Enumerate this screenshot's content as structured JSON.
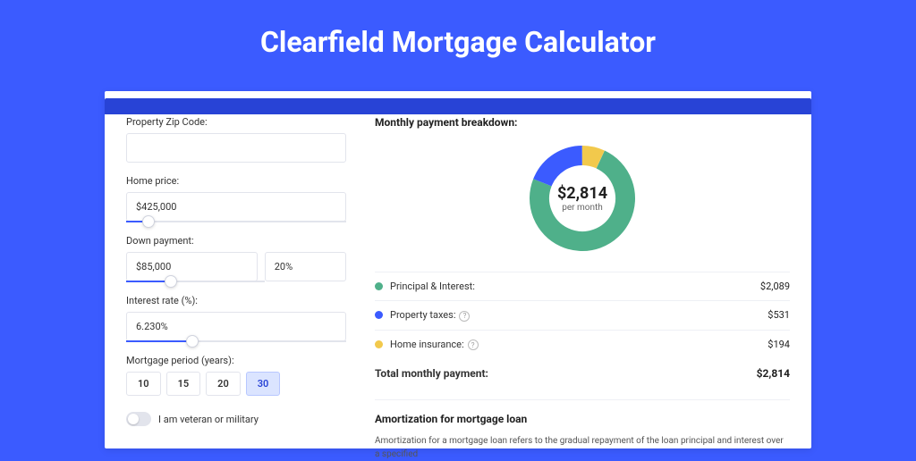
{
  "title": "Clearfield Mortgage Calculator",
  "form": {
    "zip_label": "Property Zip Code:",
    "zip_value": "",
    "price_label": "Home price:",
    "price_value": "$425,000",
    "price_pct": 10,
    "down_label": "Down payment:",
    "down_value": "$85,000",
    "down_pct_value": "20%",
    "down_pct": 20,
    "rate_label": "Interest rate (%):",
    "rate_value": "6.230%",
    "rate_pct": 30,
    "period_label": "Mortgage period (years):",
    "periods": [
      "10",
      "15",
      "20",
      "30"
    ],
    "period_active": "30",
    "veteran_label": "I am veteran or military"
  },
  "breakdown": {
    "heading": "Monthly payment breakdown:",
    "center_value": "$2,814",
    "center_sub": "per month",
    "items": [
      {
        "label": "Principal & Interest:",
        "value": "$2,089",
        "color": "#4fb08a",
        "info": false
      },
      {
        "label": "Property taxes:",
        "value": "$531",
        "color": "#3b5bff",
        "info": true
      },
      {
        "label": "Home insurance:",
        "value": "$194",
        "color": "#f2c94c",
        "info": true
      }
    ],
    "total_label": "Total monthly payment:",
    "total_value": "$2,814"
  },
  "amort": {
    "heading": "Amortization for mortgage loan",
    "text": "Amortization for a mortgage loan refers to the gradual repayment of the loan principal and interest over a specified"
  },
  "chart_data": {
    "type": "pie",
    "title": "Monthly payment breakdown",
    "series": [
      {
        "name": "Principal & Interest",
        "value": 2089,
        "color": "#4fb08a"
      },
      {
        "name": "Property taxes",
        "value": 531,
        "color": "#3b5bff"
      },
      {
        "name": "Home insurance",
        "value": 194,
        "color": "#f2c94c"
      }
    ],
    "total": 2814
  }
}
